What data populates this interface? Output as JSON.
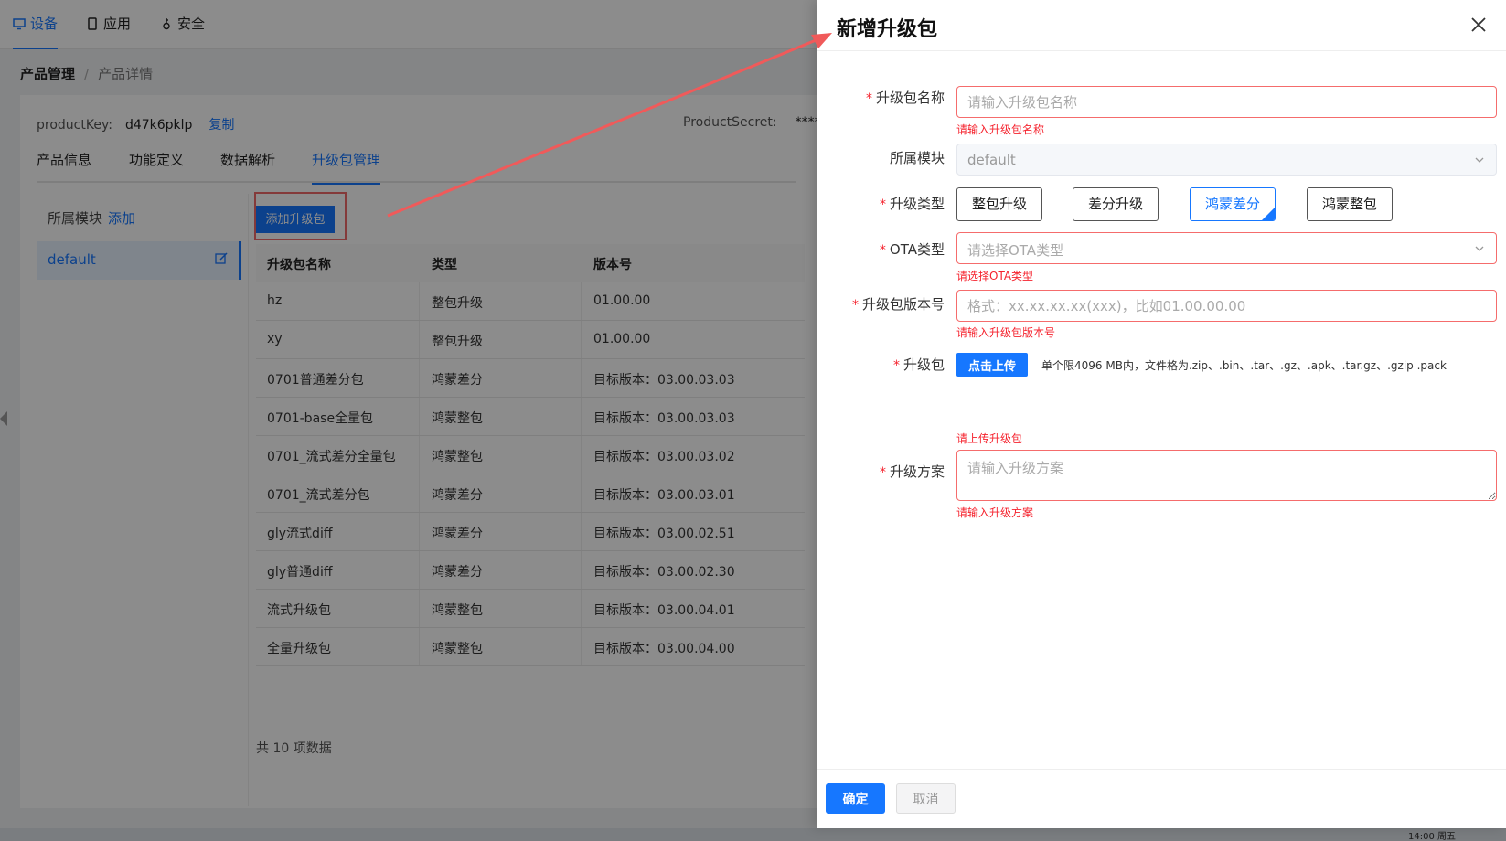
{
  "topnav": {
    "items": [
      {
        "label": "设备",
        "icon": "monitor-icon",
        "active": true
      },
      {
        "label": "应用",
        "icon": "tablet-icon",
        "active": false
      },
      {
        "label": "安全",
        "icon": "key-icon",
        "active": false
      }
    ]
  },
  "breadcrumb": {
    "root": "产品管理",
    "sep": "/",
    "current": "产品详情"
  },
  "product": {
    "key_label": "productKey:",
    "key_value": "d47k6pklp",
    "copy_label": "复制",
    "secret_label": "ProductSecret:",
    "secret_value": "****"
  },
  "tabs": [
    "产品信息",
    "功能定义",
    "数据解析",
    "升级包管理"
  ],
  "active_tab": "升级包管理",
  "sidebar": {
    "title": "所属模块",
    "add_label": "添加",
    "items": [
      "default"
    ]
  },
  "add_button_label": "添加升级包",
  "table": {
    "columns": [
      "升级包名称",
      "类型",
      "版本号"
    ],
    "rows": [
      [
        "hz",
        "整包升级",
        "01.00.00"
      ],
      [
        "xy",
        "整包升级",
        "01.00.00"
      ],
      [
        "0701普通差分包",
        "鸿蒙差分",
        "目标版本：03.00.03.03"
      ],
      [
        "0701-base全量包",
        "鸿蒙整包",
        "目标版本：03.00.03.03"
      ],
      [
        "0701_流式差分全量包",
        "鸿蒙整包",
        "目标版本：03.00.03.02"
      ],
      [
        "0701_流式差分包",
        "鸿蒙差分",
        "目标版本：03.00.03.01"
      ],
      [
        "gly流式diff",
        "鸿蒙差分",
        "目标版本：03.00.02.51"
      ],
      [
        "gly普通diff",
        "鸿蒙差分",
        "目标版本：03.00.02.30"
      ],
      [
        "流式升级包",
        "鸿蒙整包",
        "目标版本：03.00.04.01"
      ],
      [
        "全量升级包",
        "鸿蒙整包",
        "目标版本：03.00.04.00"
      ]
    ],
    "total": "共 10 项数据"
  },
  "drawer": {
    "title": "新增升级包",
    "fields": {
      "name": {
        "label": "升级包名称",
        "placeholder": "请输入升级包名称",
        "error": "请输入升级包名称"
      },
      "module": {
        "label": "所属模块",
        "value": "default"
      },
      "type": {
        "label": "升级类型",
        "options": [
          "整包升级",
          "差分升级",
          "鸿蒙差分",
          "鸿蒙整包"
        ],
        "selected": "鸿蒙差分"
      },
      "ota": {
        "label": "OTA类型",
        "placeholder": "请选择OTA类型",
        "error": "请选择OTA类型"
      },
      "version": {
        "label": "升级包版本号",
        "placeholder": "格式：xx.xx.xx.xx(xxx)，比如01.00.00.00",
        "error": "请输入升级包版本号"
      },
      "package": {
        "label": "升级包",
        "button": "点击上传",
        "hint": "单个限4096 MB内，文件格为.zip、.bin、.tar、.gz、.apk、.tar.gz、.gzip .pack",
        "error": "请上传升级包"
      },
      "plan": {
        "label": "升级方案",
        "placeholder": "请输入升级方案",
        "error": "请输入升级方案"
      }
    },
    "confirm_label": "确定",
    "cancel_label": "取消"
  },
  "taskbar": {
    "clock": "14:00 周五"
  },
  "colors": {
    "primary": "#1677ff",
    "error": "#f5222d",
    "annotation": "#f05a5a"
  }
}
